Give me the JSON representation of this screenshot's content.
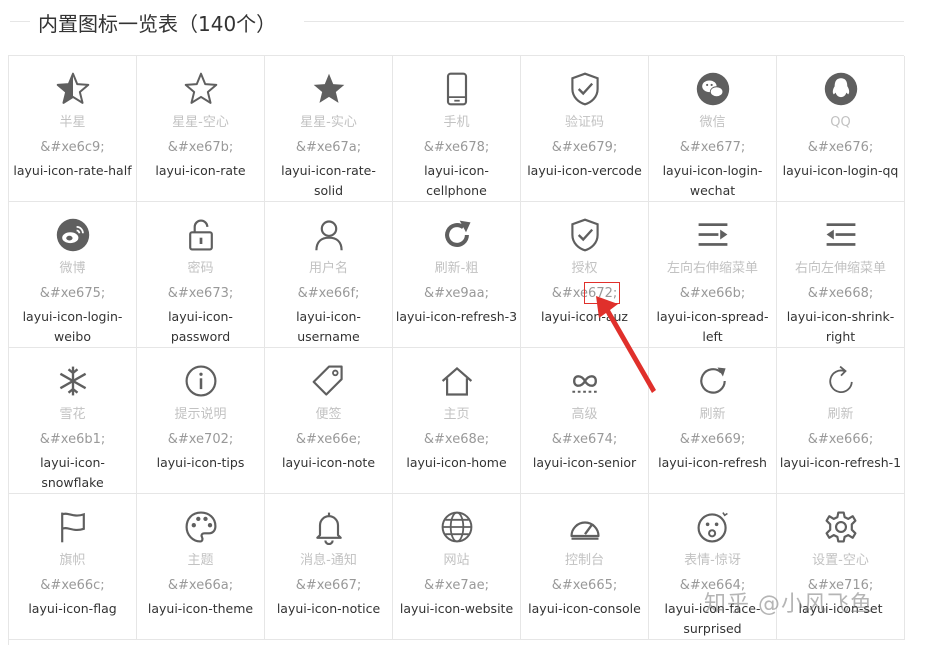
{
  "legend": {
    "title": "内置图标一览表（140个）"
  },
  "icons": [
    {
      "name": "半星",
      "code": "&#xe6c9;",
      "cls": "layui-icon-rate-half",
      "icon": "star-half-icon"
    },
    {
      "name": "星星-空心",
      "code": "&#xe67b;",
      "cls": "layui-icon-rate",
      "icon": "star-outline-icon"
    },
    {
      "name": "星星-实心",
      "code": "&#xe67a;",
      "cls": "layui-icon-rate-solid",
      "icon": "star-solid-icon"
    },
    {
      "name": "手机",
      "code": "&#xe678;",
      "cls": "layui-icon-cellphone",
      "icon": "cellphone-icon"
    },
    {
      "name": "验证码",
      "code": "&#xe679;",
      "cls": "layui-icon-vercode",
      "icon": "shield-check-icon"
    },
    {
      "name": "微信",
      "code": "&#xe677;",
      "cls": "layui-icon-login-wechat",
      "icon": "wechat-icon"
    },
    {
      "name": "QQ",
      "code": "&#xe676;",
      "cls": "layui-icon-login-qq",
      "icon": "qq-icon"
    },
    {
      "name": "微博",
      "code": "&#xe675;",
      "cls": "layui-icon-login-weibo",
      "icon": "weibo-icon"
    },
    {
      "name": "密码",
      "code": "&#xe673;",
      "cls": "layui-icon-password",
      "icon": "lock-open-icon"
    },
    {
      "name": "用户名",
      "code": "&#xe66f;",
      "cls": "layui-icon-username",
      "icon": "user-icon"
    },
    {
      "name": "刷新-粗",
      "code": "&#xe9aa;",
      "cls": "layui-icon-refresh-3",
      "icon": "refresh-bold-icon"
    },
    {
      "name": "授权",
      "code": "&#xe672;",
      "cls": "layui-icon-auz",
      "icon": "shield-auth-icon"
    },
    {
      "name": "左向右伸缩菜单",
      "code": "&#xe66b;",
      "cls": "layui-icon-spread-left",
      "icon": "menu-spread-left-icon"
    },
    {
      "name": "右向左伸缩菜单",
      "code": "&#xe668;",
      "cls": "layui-icon-shrink-right",
      "icon": "menu-shrink-right-icon"
    },
    {
      "name": "雪花",
      "code": "&#xe6b1;",
      "cls": "layui-icon-snowflake",
      "icon": "snowflake-icon"
    },
    {
      "name": "提示说明",
      "code": "&#xe702;",
      "cls": "layui-icon-tips",
      "icon": "info-icon"
    },
    {
      "name": "便签",
      "code": "&#xe66e;",
      "cls": "layui-icon-note",
      "icon": "tag-icon"
    },
    {
      "name": "主页",
      "code": "&#xe68e;",
      "cls": "layui-icon-home",
      "icon": "home-icon"
    },
    {
      "name": "高级",
      "code": "&#xe674;",
      "cls": "layui-icon-senior",
      "icon": "infinity-icon"
    },
    {
      "name": "刷新",
      "code": "&#xe669;",
      "cls": "layui-icon-refresh",
      "icon": "refresh-icon"
    },
    {
      "name": "刷新",
      "code": "&#xe666;",
      "cls": "layui-icon-refresh-1",
      "icon": "refresh-thin-icon"
    },
    {
      "name": "旗帜",
      "code": "&#xe66c;",
      "cls": "layui-icon-flag",
      "icon": "flag-icon"
    },
    {
      "name": "主题",
      "code": "&#xe66a;",
      "cls": "layui-icon-theme",
      "icon": "palette-icon"
    },
    {
      "name": "消息-通知",
      "code": "&#xe667;",
      "cls": "layui-icon-notice",
      "icon": "bell-icon"
    },
    {
      "name": "网站",
      "code": "&#xe7ae;",
      "cls": "layui-icon-website",
      "icon": "globe-icon"
    },
    {
      "name": "控制台",
      "code": "&#xe665;",
      "cls": "layui-icon-console",
      "icon": "gauge-icon"
    },
    {
      "name": "表情-惊讶",
      "code": "&#xe664;",
      "cls": "layui-icon-face-surprised",
      "icon": "face-surprised-icon"
    },
    {
      "name": "设置-空心",
      "code": "&#xe716;",
      "cls": "layui-icon-set",
      "icon": "gear-icon"
    }
  ],
  "watermark": "知乎 @小风飞鱼",
  "colors": {
    "icon": "#5f5f5f",
    "marker": "#e0302b"
  }
}
